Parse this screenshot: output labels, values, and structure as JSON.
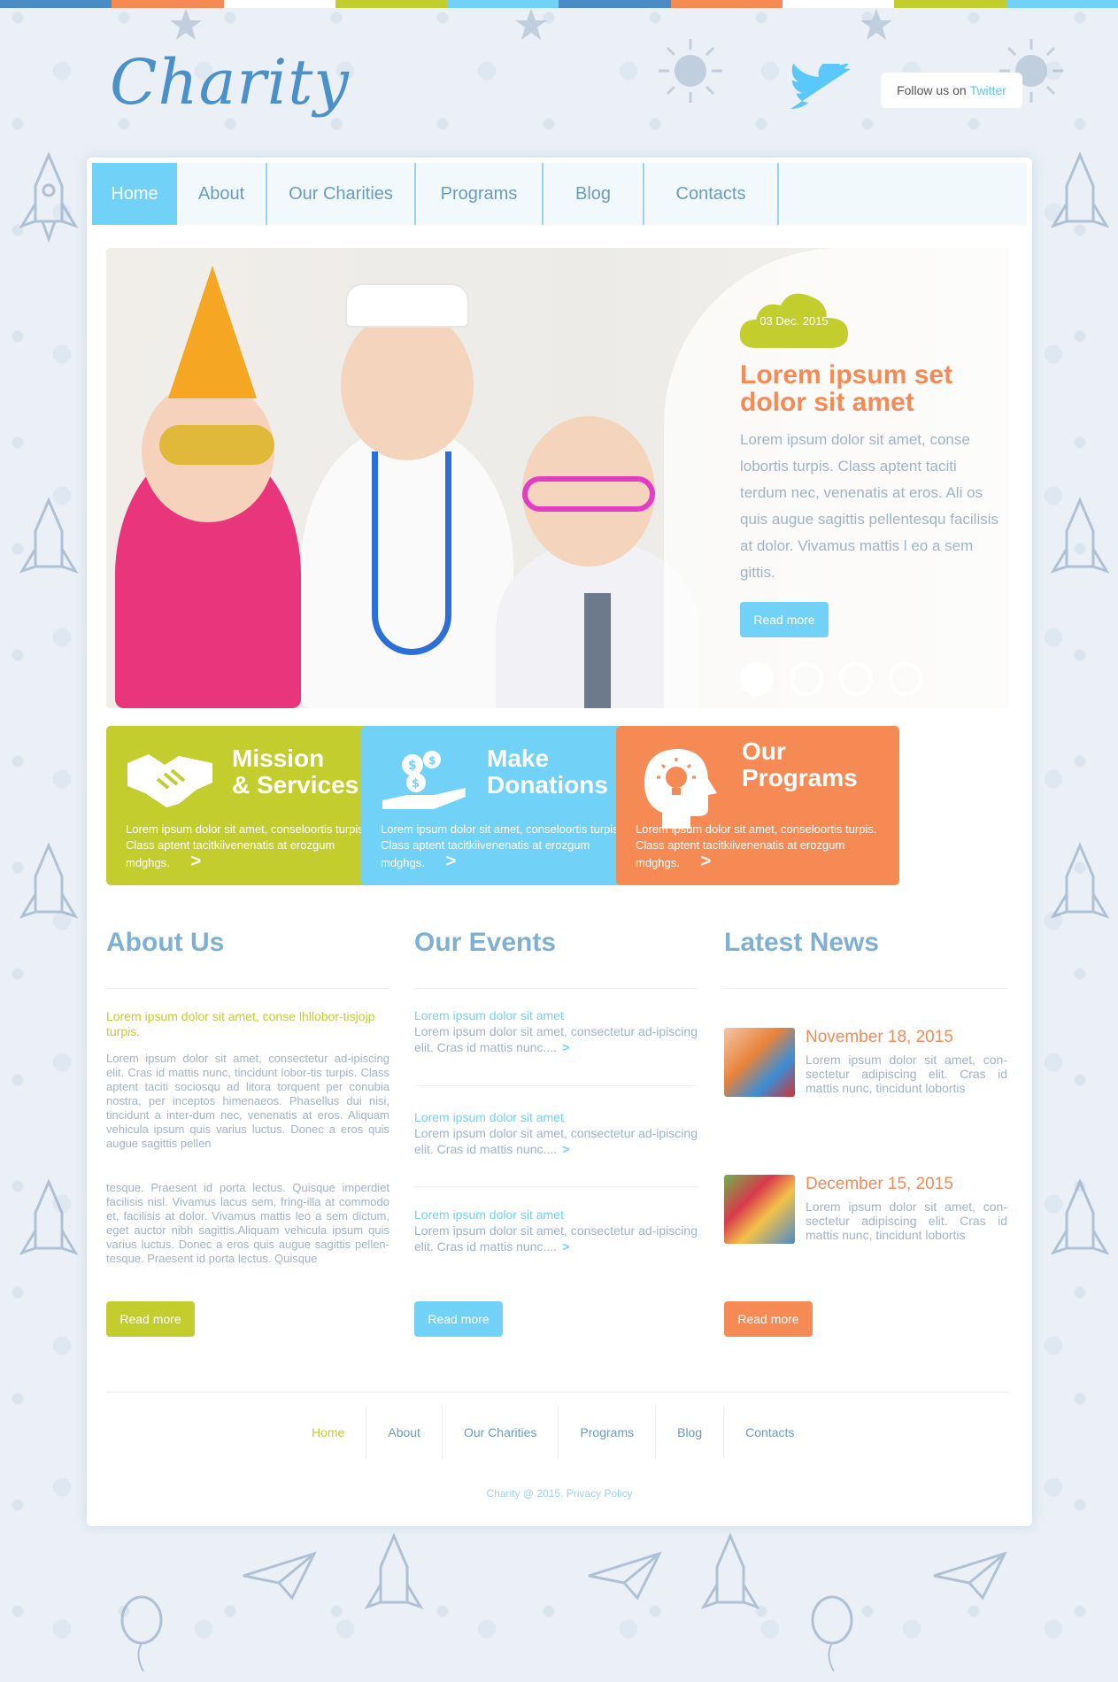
{
  "colors": {
    "green": "#c3cd2e",
    "blue": "#72d1f7",
    "orange": "#f58a55",
    "nav_text": "#6a9cc0",
    "body_text": "#9fb3c9",
    "top_stripes": [
      "#4a8cc7",
      "#f58a55",
      "#ffffff",
      "#c3cd2e",
      "#72d1f7",
      "#4a8cc7",
      "#f58a55",
      "#ffffff",
      "#c3cd2e",
      "#72d1f7"
    ]
  },
  "header": {
    "logo_text": "Charity",
    "follow_label": "Follow us on",
    "twitter_label": "Twitter",
    "twitter_icon": "twitter-bird-icon"
  },
  "nav": {
    "items": [
      {
        "label": "Home",
        "active": true
      },
      {
        "label": "About"
      },
      {
        "label": "Our Charities"
      },
      {
        "label": "Programs"
      },
      {
        "label": "Blog"
      },
      {
        "label": "Contacts"
      }
    ]
  },
  "slider": {
    "date": "03 Dec. 2015",
    "title": "Lorem ipsum set dolor sit amet",
    "text": "Lorem ipsum dolor sit amet, conse lobortis turpis. Class aptent taciti terdum nec, venenatis at eros. Ali os quis augue sagittis pellentesqu facilisis at dolor. Vivamus mattis l eo a sem gittis.",
    "button": "Read more",
    "dots": 4,
    "active_dot": 1
  },
  "features": [
    {
      "title_line1": "Mission",
      "title_line2": "& Services",
      "text": "Lorem ipsum dolor sit amet, conseloortis turpis. Class aptent tacitkiivenenatis at erozgum mdghgs.",
      "icon": "handshake-icon",
      "color": "#c3cd2e"
    },
    {
      "title_line1": "Make",
      "title_line2": "Donations",
      "text": "Lorem ipsum dolor sit amet, conseloortis turpis. Class aptent tacitkiivenenatis at erozgum mdghgs.",
      "icon": "donation-hand-icon",
      "color": "#72d1f7"
    },
    {
      "title_line1": "Our",
      "title_line2": "Programs",
      "text": "Lorem ipsum dolor sit amet, conseloortis turpis. Class aptent tacitkiivenenatis at erozgum mdghgs.",
      "icon": "lightbulb-head-icon",
      "color": "#f58a55"
    }
  ],
  "about": {
    "title": "About Us",
    "lead": "Lorem ipsum dolor sit amet, conse lhllobor-tisjojp turpis.",
    "para1": "Lorem ipsum dolor sit amet, consectetur ad-ipiscing elit. Cras id mattis nunc, tincidunt lobor-tis turpis. Class aptent taciti sociosqu ad litora torquent per conubia nostra, per inceptos himenaeos. Phasellus dui nisi, tincidunt a inter-dum nec, venenatis at eros. Aliquam vehicula ipsum quis varius luctus. Donec a eros quis augue sagittis pellen",
    "para2": "tesque. Praesent id porta lectus. Quisque imperdiet facilisis nisl. Vivamus lacus sem, fring-illa at commodo et, facilisis at dolor. Vivamus mattis leo a sem dictum, eget auctor nibh sagittis.Aliquam vehicula ipsum quis varius luctus. Donec a eros quis augue sagittis pellen-tesque. Praesent id porta lectus. Quisque",
    "button": "Read more"
  },
  "events": {
    "title": "Our Events",
    "items": [
      {
        "title": "Lorem ipsum dolor sit amet",
        "text": "Lorem ipsum dolor sit amet, consectetur ad-ipiscing elit. Cras id mattis nunc...."
      },
      {
        "title": "Lorem ipsum dolor sit amet",
        "text": "Lorem ipsum dolor sit amet, consectetur ad-ipiscing elit. Cras id mattis nunc...."
      },
      {
        "title": "Lorem ipsum dolor sit amet",
        "text": "Lorem ipsum dolor sit amet, consectetur ad-ipiscing elit. Cras id mattis nunc...."
      }
    ],
    "arrow": ">",
    "button": "Read more"
  },
  "news": {
    "title": "Latest News",
    "items": [
      {
        "date": "November 18, 2015",
        "text": "Lorem ipsum dolor sit amet, con-sectetur adipiscing elit. Cras id mattis nunc, tincidunt lobortis"
      },
      {
        "date": "December 15, 2015",
        "text": "Lorem ipsum dolor sit amet, con-sectetur adipiscing elit. Cras id mattis nunc, tincidunt lobortis"
      }
    ],
    "button": "Read more"
  },
  "footer": {
    "nav": [
      {
        "label": "Home",
        "active": true
      },
      {
        "label": "About"
      },
      {
        "label": "Our Charities"
      },
      {
        "label": "Programs"
      },
      {
        "label": "Blog"
      },
      {
        "label": "Contacts"
      }
    ],
    "copyright_prefix": "Charity @ 2015.",
    "privacy_link": "Privacy Policy"
  }
}
